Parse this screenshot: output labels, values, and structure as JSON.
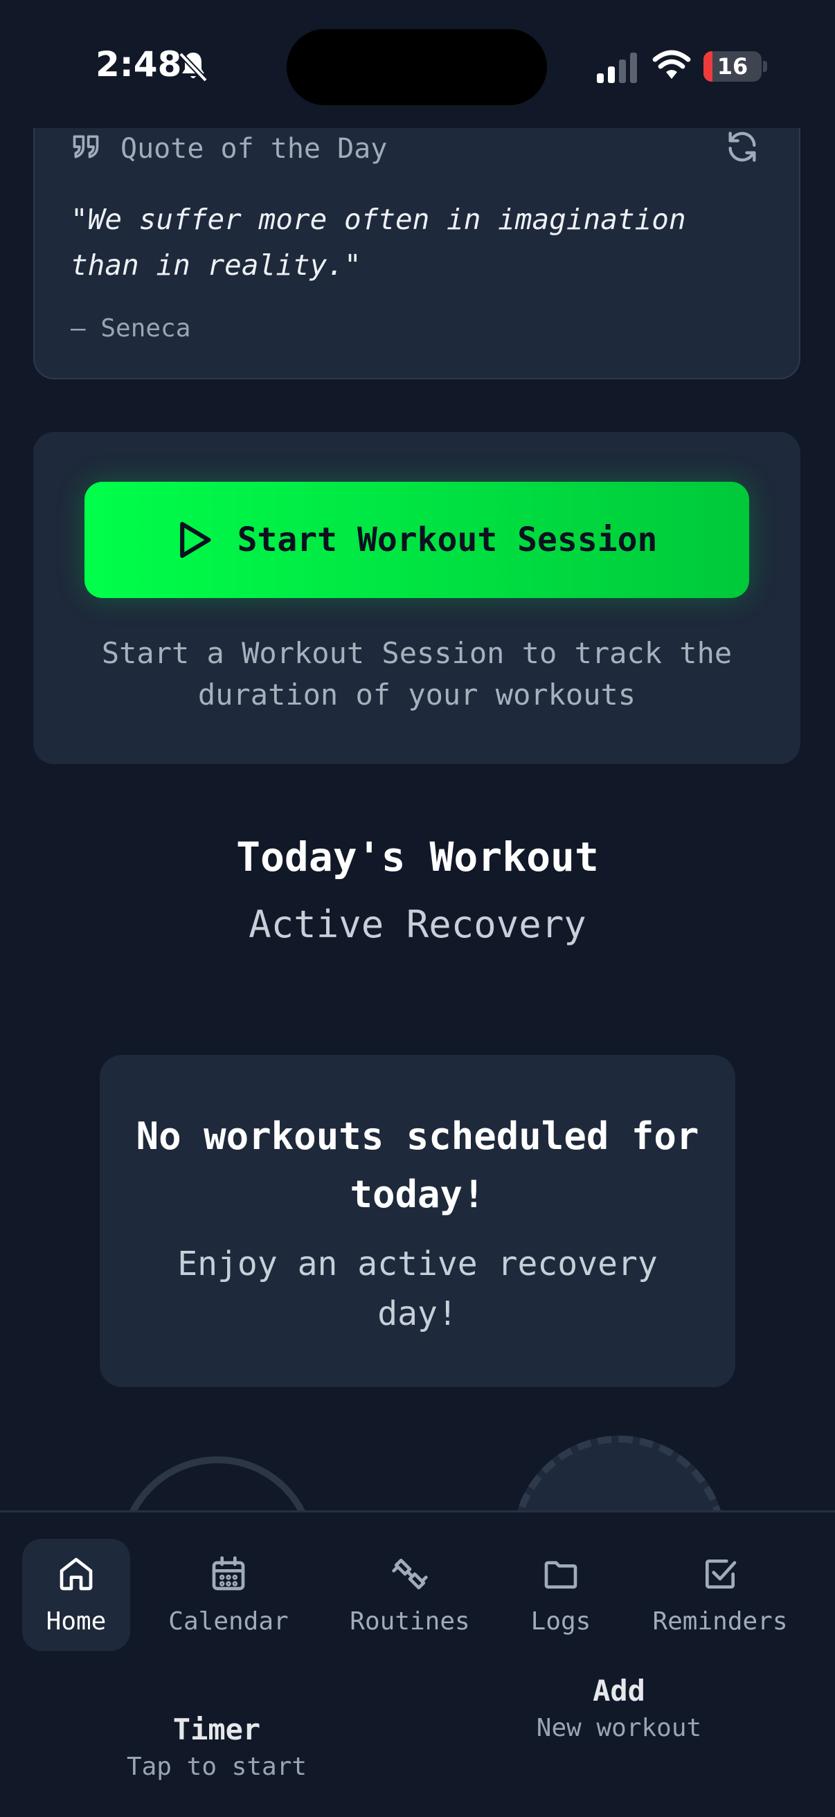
{
  "status_bar": {
    "time": "2:48",
    "battery_level": "16",
    "battery_fraction": 0.16,
    "icons": [
      "bell-slash-icon",
      "cellular-signal-icon",
      "wifi-icon",
      "battery-icon"
    ]
  },
  "quote": {
    "heading": "Quote of the Day",
    "text": "\"We suffer more often in imagination than in reality.\"",
    "author": "— Seneca",
    "icons": [
      "quote-icon",
      "refresh-icon"
    ]
  },
  "session": {
    "start_label": "Start Workout Session",
    "hint": "Start a Workout Session to track the duration of your workouts",
    "icon": "play-icon"
  },
  "today": {
    "title": "Today's Workout",
    "subtitle": "Active Recovery",
    "empty_title": "No workouts scheduled for today!",
    "empty_message": "Enjoy an active recovery day!"
  },
  "timer": {
    "label": "Timer",
    "sublabel": "Tap to start"
  },
  "add_workout": {
    "label": "Add",
    "sublabel": "New workout"
  },
  "nav": {
    "items": [
      {
        "label": "Home",
        "icon": "home-icon",
        "active": true
      },
      {
        "label": "Calendar",
        "icon": "calendar-icon"
      },
      {
        "label": "Routines",
        "icon": "dumbbell-icon"
      },
      {
        "label": "Logs",
        "icon": "folder-icon"
      },
      {
        "label": "Reminders",
        "icon": "checkbox-icon"
      }
    ]
  },
  "colors": {
    "background": "#111827",
    "card": "#1e293b",
    "accent": "#00ff4a",
    "battery_low": "#ef3b3b"
  }
}
